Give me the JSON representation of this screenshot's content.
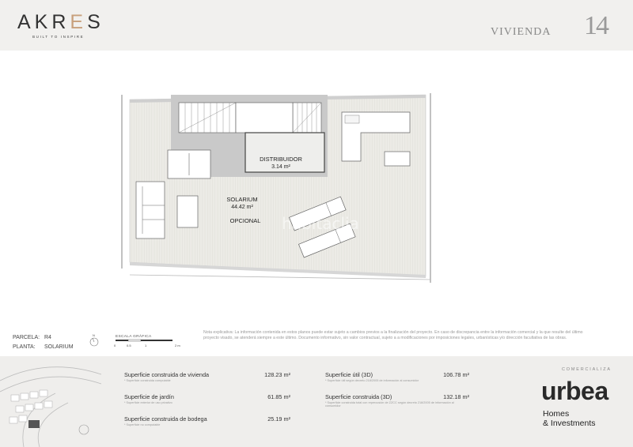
{
  "header": {
    "logo_prefix": "AKR",
    "logo_highlight": "E",
    "logo_suffix": "S",
    "tagline": "BUILT TO INSPIRE",
    "type_label": "VIVIENDA",
    "unit_number": "14"
  },
  "plan": {
    "rooms": [
      {
        "name": "DISTRIBUIDOR",
        "area": "3.14 m²"
      },
      {
        "name": "SOLARIUM",
        "area": "44.42 m²",
        "note": "OPCIONAL"
      }
    ],
    "watermark": "habitaclia"
  },
  "info": {
    "parcela_label": "PARCELA:",
    "parcela_value": "R4",
    "planta_label": "PLANTA:",
    "planta_value": "SOLARIUM",
    "north_label": "N",
    "scale_title": "ESCALA GRÁFICA",
    "scale_ticks": [
      "0",
      "0.5",
      "1",
      "2 m"
    ]
  },
  "note": "Nota explicativa: La información contenida en estos planos puede estar sujeto a cambios previos a la finalización del proyecto. En caso de discrepancia entre la información comercial y la que resulte del último proyecto visado, se atenderá siempre a este último. Documento informativo, sin valor contractual, sujeto a a modificaciones por imposiciones legales, urbanísticas y/o dirección facultativa de las obras.",
  "surfaces_left": [
    {
      "label": "Superficie construida de vivienda",
      "sub": "* Superficie construida computable",
      "value": "128.23 m²"
    },
    {
      "label": "Superficie de jardín",
      "sub": "* Superficie exterior de uso privativo",
      "value": "61.85 m²"
    },
    {
      "label": "Superficie construida de bodega",
      "sub": "* Superficie no computable",
      "value": "25.19 m²"
    }
  ],
  "surfaces_right": [
    {
      "label": "Superficie útil (3D)",
      "sub": "* Superficie útil según decreto 218/2005 de información al consumidor",
      "value": "106.78 m²"
    },
    {
      "label": "Superficie construida (3D)",
      "sub": "* Superficie construida total con repercusión de ZZCC según decreto 218/2005 de información al consumidor",
      "value": "132.18 m²"
    }
  ],
  "marketer": {
    "label": "COMERCIALIZA",
    "brand": "urbea",
    "line1": "Homes",
    "line2": "& Investments"
  }
}
